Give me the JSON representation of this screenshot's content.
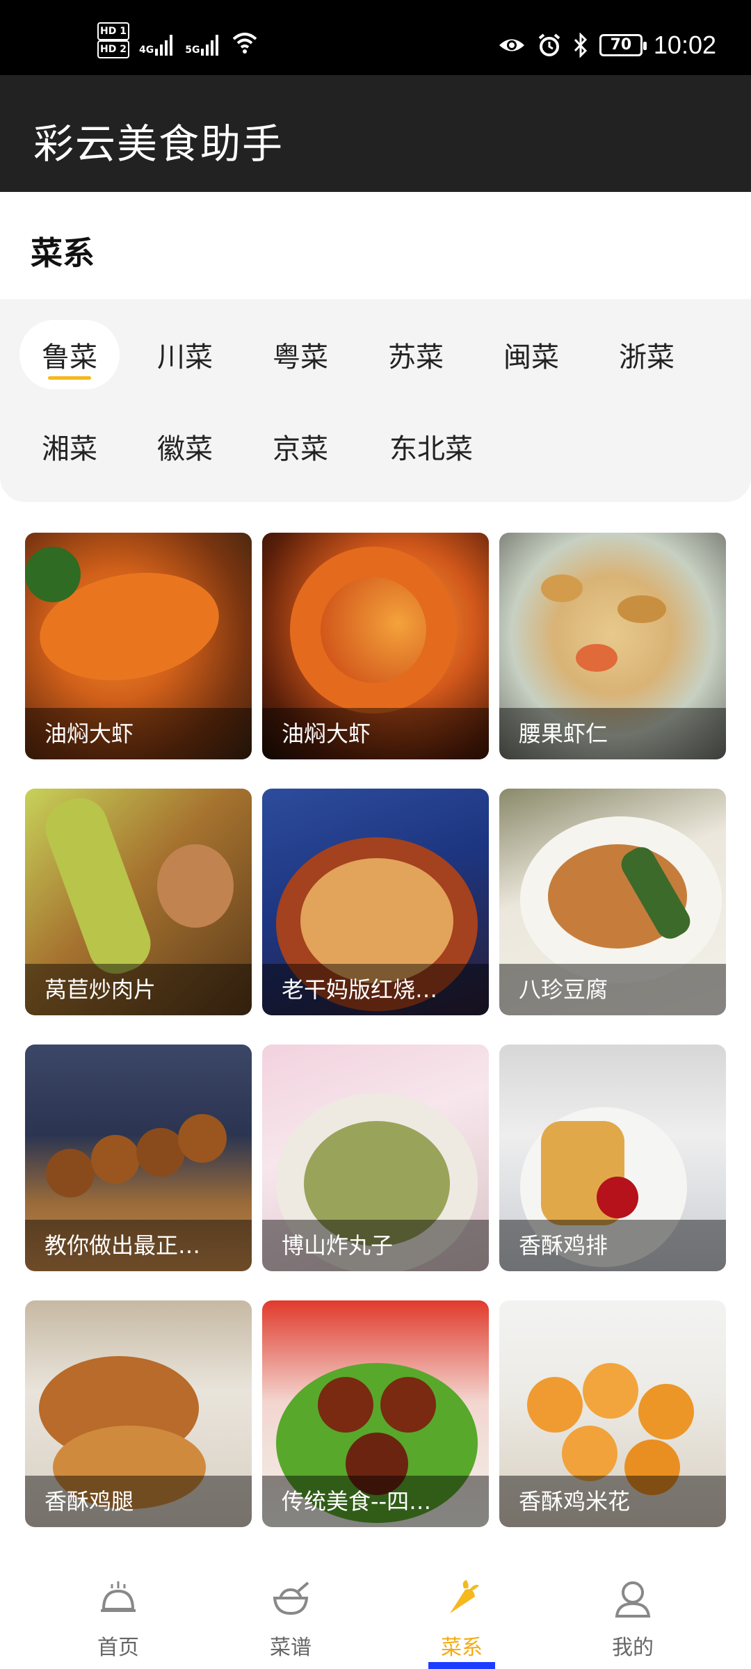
{
  "status_bar": {
    "sim1": "HD 1",
    "sim2": "HD 2",
    "net1": "4G",
    "net2": "5G",
    "battery": "70",
    "time": "10:02"
  },
  "app_bar": {
    "title": "彩云美食助手"
  },
  "section": {
    "title": "菜系"
  },
  "categories": [
    {
      "label": "鲁菜"
    },
    {
      "label": "川菜"
    },
    {
      "label": "粤菜"
    },
    {
      "label": "苏菜"
    },
    {
      "label": "闽菜"
    },
    {
      "label": "浙菜"
    },
    {
      "label": "湘菜"
    },
    {
      "label": "徽菜"
    },
    {
      "label": "京菜"
    },
    {
      "label": "东北菜"
    }
  ],
  "selected_category": "鲁菜",
  "dishes": [
    {
      "name": "油焖大虾"
    },
    {
      "name": "油焖大虾"
    },
    {
      "name": "腰果虾仁"
    },
    {
      "name": "莴苣炒肉片"
    },
    {
      "name": "老干妈版红烧…"
    },
    {
      "name": "八珍豆腐"
    },
    {
      "name": "教你做出最正…"
    },
    {
      "name": "博山炸丸子"
    },
    {
      "name": "香酥鸡排"
    },
    {
      "name": "香酥鸡腿"
    },
    {
      "name": "传统美食--四…"
    },
    {
      "name": "香酥鸡米花"
    }
  ],
  "bottom_nav": {
    "home": "首页",
    "recipes": "菜谱",
    "cuisines": "菜系",
    "mine": "我的",
    "active": "菜系",
    "active_color": "#f5a913"
  }
}
